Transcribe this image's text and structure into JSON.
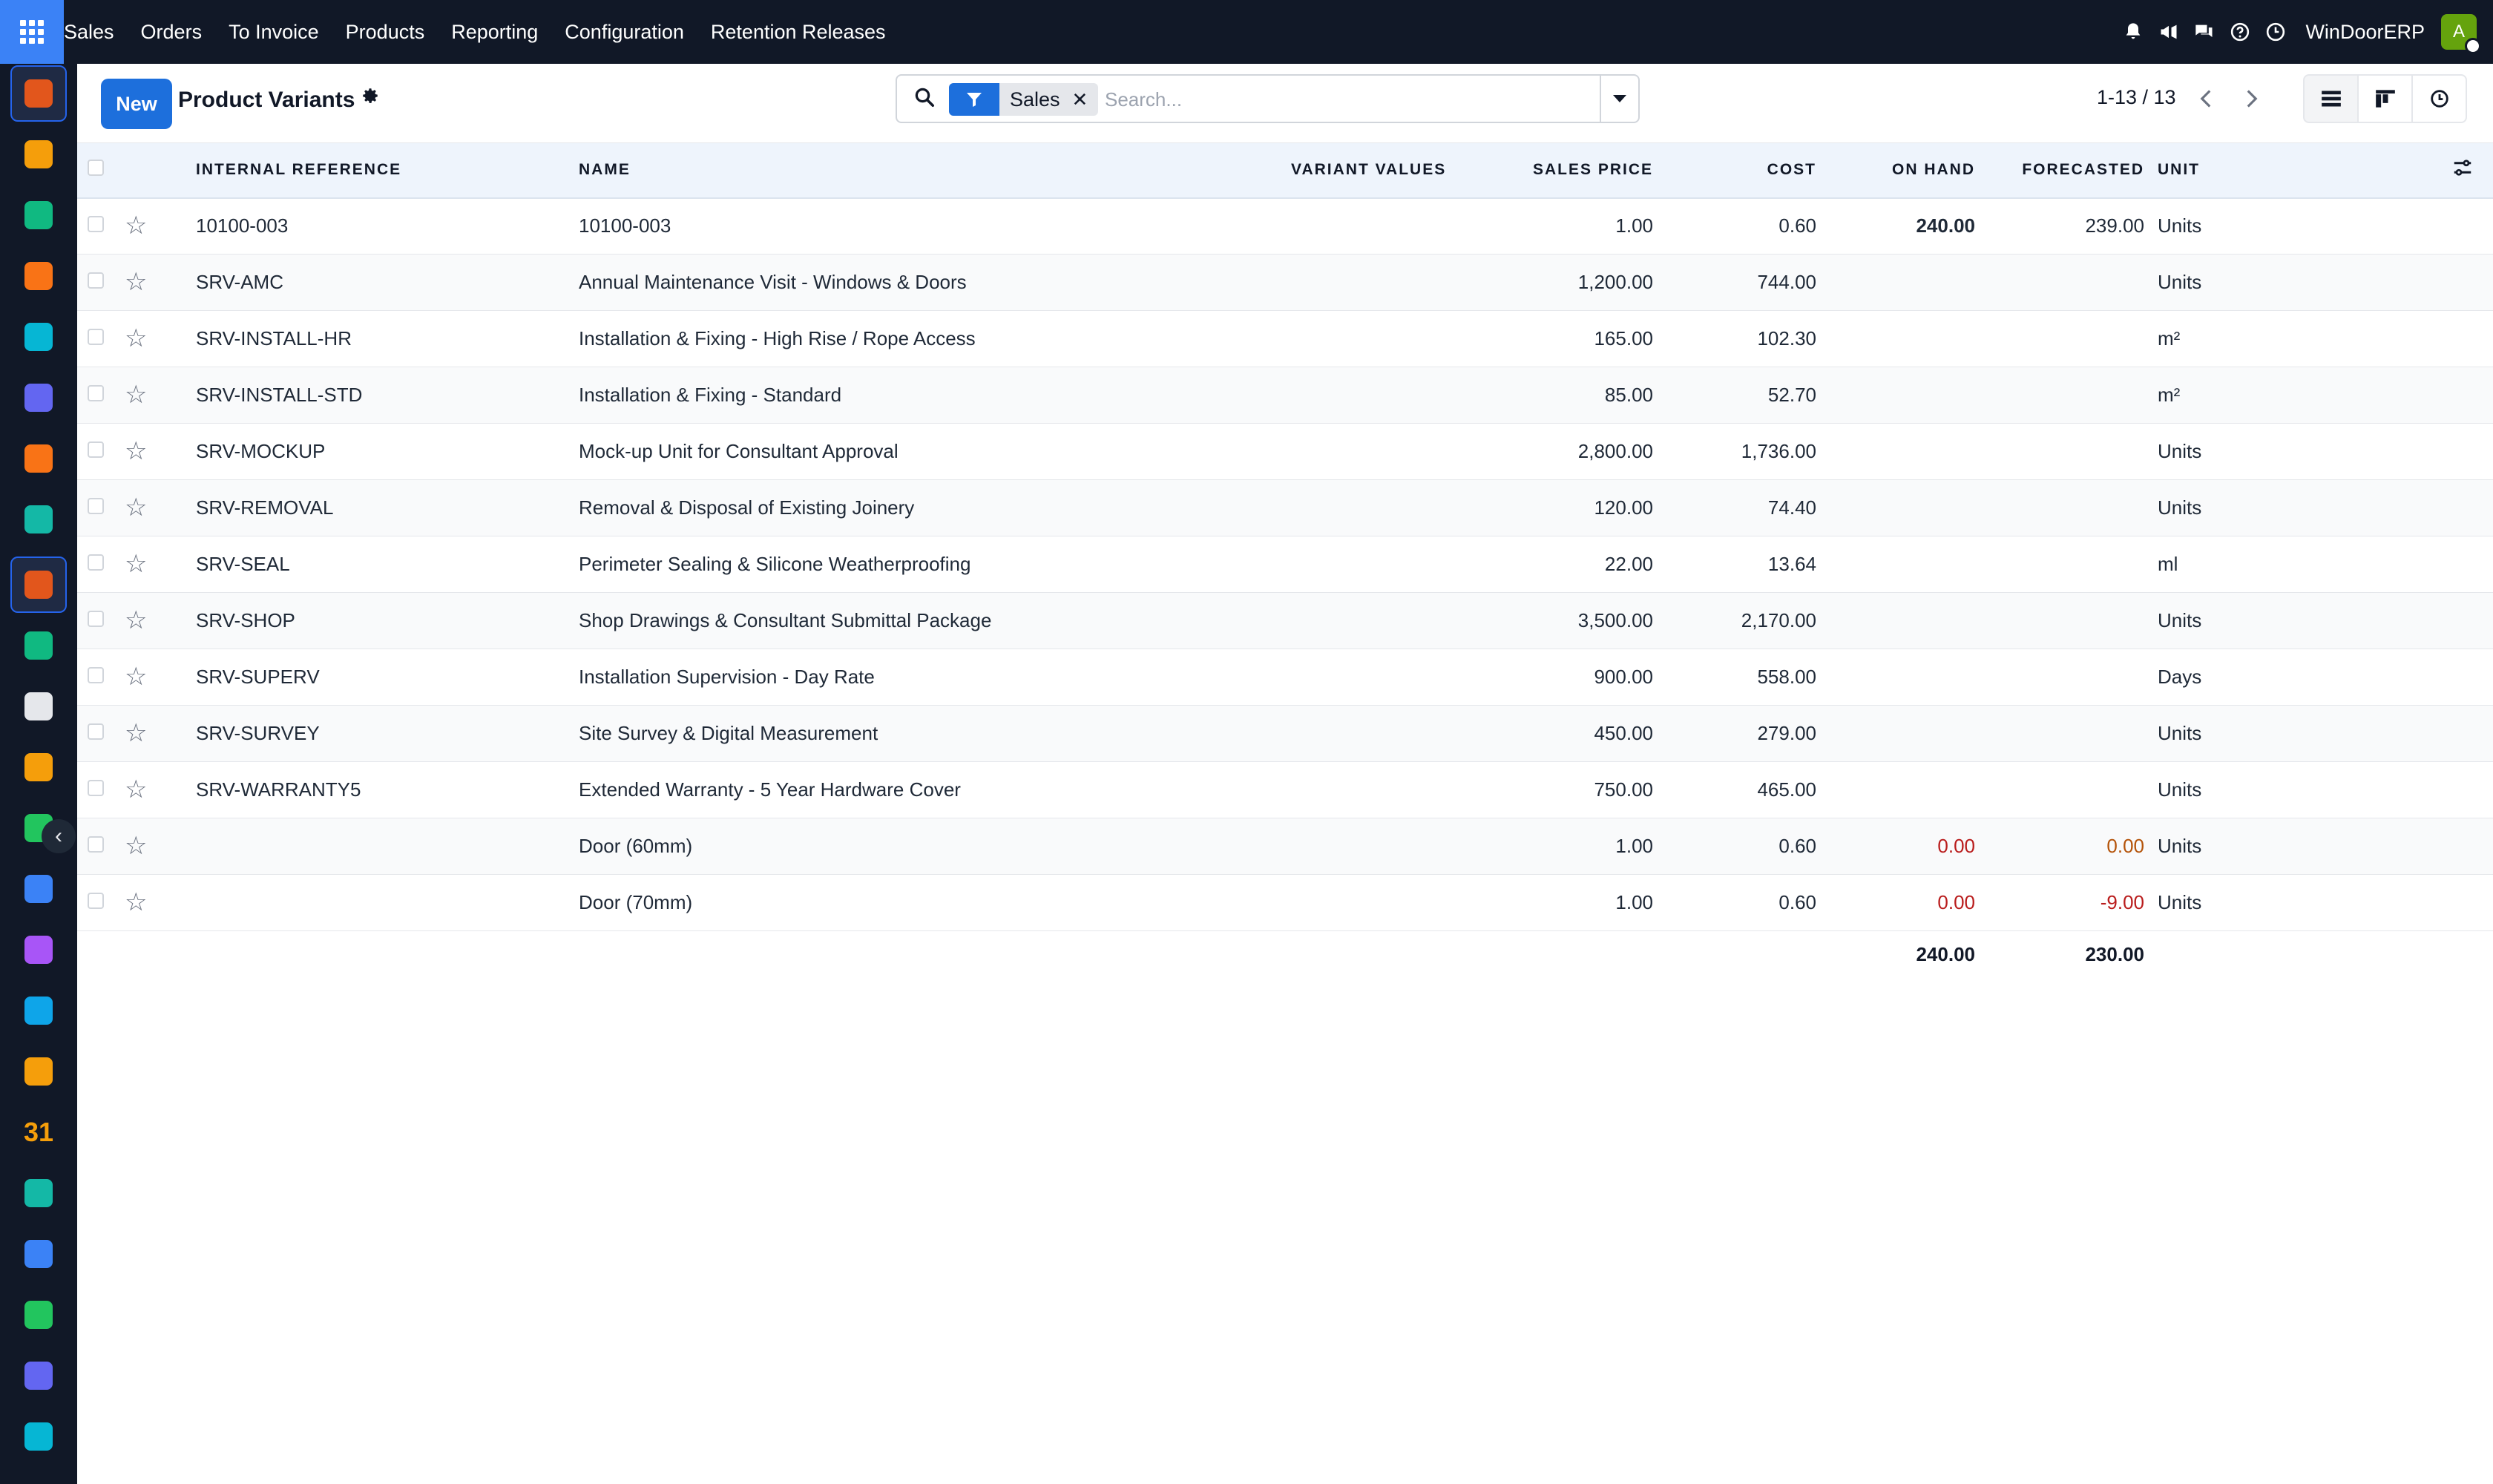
{
  "topbar": {
    "menu": [
      "Sales",
      "Orders",
      "To Invoice",
      "Products",
      "Reporting",
      "Configuration",
      "Retention Releases"
    ],
    "company": "WinDoorERP",
    "avatar_initial": "A",
    "icons": [
      "bell-icon",
      "megaphone-icon",
      "chat-icon",
      "help-icon",
      "clock-icon"
    ]
  },
  "sidebar": {
    "apps": [
      {
        "name": "sales-app",
        "color": "#e2561c"
      },
      {
        "name": "studio-app",
        "color": "#f59e0b"
      },
      {
        "name": "contacts-app",
        "color": "#10b981"
      },
      {
        "name": "discuss-app",
        "color": "#f97316"
      },
      {
        "name": "website-app",
        "color": "#06b6d4"
      },
      {
        "name": "email-app",
        "color": "#6366f1"
      },
      {
        "name": "chat-app",
        "color": "#f97316"
      },
      {
        "name": "flow-app",
        "color": "#14b8a6"
      },
      {
        "name": "sales-app-active",
        "color": "#e2561c"
      },
      {
        "name": "contacts-app-2",
        "color": "#10b981"
      },
      {
        "name": "inventory-app",
        "color": "#e5e7eb"
      },
      {
        "name": "studio-app-2",
        "color": "#f59e0b"
      },
      {
        "name": "todo-app",
        "color": "#22c55e"
      },
      {
        "name": "knowledge-app",
        "color": "#3b82f6"
      },
      {
        "name": "purchase-app",
        "color": "#a855f7"
      },
      {
        "name": "accounting-app",
        "color": "#0ea5e9"
      },
      {
        "name": "employees-app",
        "color": "#f59e0b"
      },
      {
        "name": "calendar-app",
        "color": "#f59e0b"
      },
      {
        "name": "sign-app",
        "color": "#14b8a6"
      },
      {
        "name": "dashboards-app",
        "color": "#3b82f6"
      },
      {
        "name": "whatsapp-app",
        "color": "#22c55e"
      },
      {
        "name": "timesheet-app",
        "color": "#6366f1"
      },
      {
        "name": "website-app-2",
        "color": "#06b6d4"
      }
    ],
    "calendar_label": "31"
  },
  "control": {
    "new_label": "New",
    "title": "Product Variants",
    "facet_label": "Sales",
    "search_placeholder": "Search...",
    "pager": "1-13 / 13"
  },
  "table": {
    "headers": {
      "ref": "Internal Reference",
      "name": "Name",
      "variant": "Variant Values",
      "price": "Sales Price",
      "cost": "Cost",
      "onhand": "On Hand",
      "forecast": "Forecasted",
      "unit": "Unit"
    },
    "rows": [
      {
        "ref": "10100-003",
        "name": "10100-003",
        "variant": "",
        "price": "1.00",
        "cost": "0.60",
        "onhand": "240.00",
        "forecast": "239.00",
        "unit": "Units"
      },
      {
        "ref": "SRV-AMC",
        "name": "Annual Maintenance Visit - Windows & Doors",
        "variant": "",
        "price": "1,200.00",
        "cost": "744.00",
        "onhand": "",
        "forecast": "",
        "unit": "Units"
      },
      {
        "ref": "SRV-INSTALL-HR",
        "name": "Installation & Fixing - High Rise / Rope Access",
        "variant": "",
        "price": "165.00",
        "cost": "102.30",
        "onhand": "",
        "forecast": "",
        "unit": "m²"
      },
      {
        "ref": "SRV-INSTALL-STD",
        "name": "Installation & Fixing - Standard",
        "variant": "",
        "price": "85.00",
        "cost": "52.70",
        "onhand": "",
        "forecast": "",
        "unit": "m²"
      },
      {
        "ref": "SRV-MOCKUP",
        "name": "Mock-up Unit for Consultant Approval",
        "variant": "",
        "price": "2,800.00",
        "cost": "1,736.00",
        "onhand": "",
        "forecast": "",
        "unit": "Units"
      },
      {
        "ref": "SRV-REMOVAL",
        "name": "Removal & Disposal of Existing Joinery",
        "variant": "",
        "price": "120.00",
        "cost": "74.40",
        "onhand": "",
        "forecast": "",
        "unit": "Units"
      },
      {
        "ref": "SRV-SEAL",
        "name": "Perimeter Sealing & Silicone Weatherproofing",
        "variant": "",
        "price": "22.00",
        "cost": "13.64",
        "onhand": "",
        "forecast": "",
        "unit": "ml"
      },
      {
        "ref": "SRV-SHOP",
        "name": "Shop Drawings & Consultant Submittal Package",
        "variant": "",
        "price": "3,500.00",
        "cost": "2,170.00",
        "onhand": "",
        "forecast": "",
        "unit": "Units"
      },
      {
        "ref": "SRV-SUPERV",
        "name": "Installation Supervision - Day Rate",
        "variant": "",
        "price": "900.00",
        "cost": "558.00",
        "onhand": "",
        "forecast": "",
        "unit": "Days"
      },
      {
        "ref": "SRV-SURVEY",
        "name": "Site Survey & Digital Measurement",
        "variant": "",
        "price": "450.00",
        "cost": "279.00",
        "onhand": "",
        "forecast": "",
        "unit": "Units"
      },
      {
        "ref": "SRV-WARRANTY5",
        "name": "Extended Warranty - 5 Year Hardware Cover",
        "variant": "",
        "price": "750.00",
        "cost": "465.00",
        "onhand": "",
        "forecast": "",
        "unit": "Units"
      },
      {
        "ref": "",
        "name": "Door (60mm)",
        "variant": "",
        "price": "1.00",
        "cost": "0.60",
        "onhand": "0.00",
        "forecast": "0.00",
        "unit": "Units"
      },
      {
        "ref": "",
        "name": "Door (70mm)",
        "variant": "",
        "price": "1.00",
        "cost": "0.60",
        "onhand": "0.00",
        "forecast": "-9.00",
        "unit": "Units"
      }
    ],
    "totals": {
      "onhand": "240.00",
      "forecast": "230.00"
    }
  },
  "colors": {
    "topbar": "#111827",
    "primary": "#1d6fdc",
    "warning": "#b45309",
    "danger": "#b91c1c"
  }
}
